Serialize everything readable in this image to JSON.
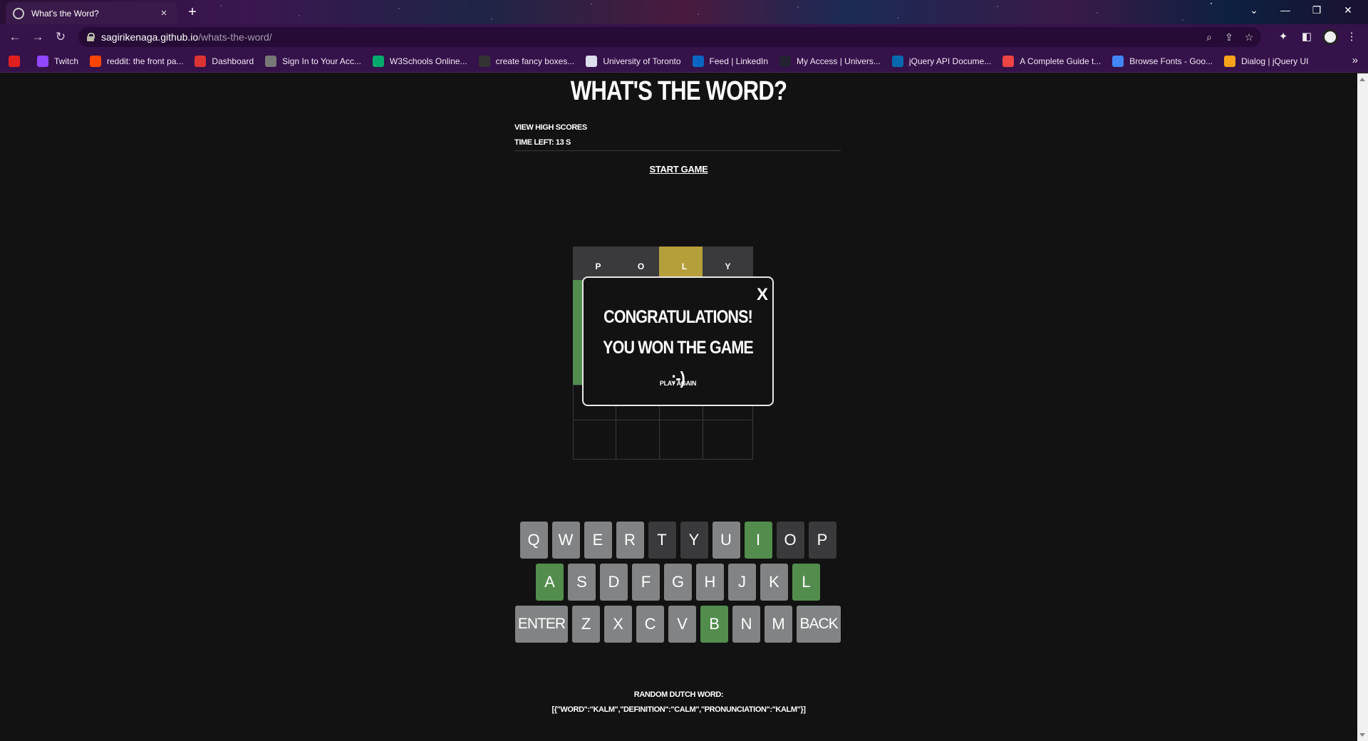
{
  "browser": {
    "tab_title": "What's the Word?",
    "tab_close": "×",
    "new_tab": "+",
    "url_host": "sagirikenaga.github.io",
    "url_path": "/whats-the-word/",
    "bookmarks": [
      {
        "label": "",
        "icon": "youtube-icon",
        "color": "#e02020"
      },
      {
        "label": "Twitch",
        "icon": "twitch-icon",
        "color": "#9146ff"
      },
      {
        "label": "reddit: the front pa...",
        "icon": "reddit-icon",
        "color": "#ff4500"
      },
      {
        "label": "Dashboard",
        "icon": "dashboard-icon",
        "color": "#d33"
      },
      {
        "label": "Sign In to Your Acc...",
        "icon": "globe-icon",
        "color": "#777"
      },
      {
        "label": "W3Schools Online...",
        "icon": "w3schools-icon",
        "color": "#04aa6d"
      },
      {
        "label": "create fancy boxes...",
        "icon": "medium-icon",
        "color": "#333"
      },
      {
        "label": "University of Toronto",
        "icon": "uoft-icon",
        "color": "#dde"
      },
      {
        "label": "Feed | LinkedIn",
        "icon": "linkedin-icon",
        "color": "#0a66c2"
      },
      {
        "label": "My Access | Univers...",
        "icon": "access-icon",
        "color": "#223"
      },
      {
        "label": "jQuery API Docume...",
        "icon": "jquery-icon",
        "color": "#0769ad"
      },
      {
        "label": "A Complete Guide t...",
        "icon": "css-tricks-icon",
        "color": "#e44"
      },
      {
        "label": "Browse Fonts - Goo...",
        "icon": "google-fonts-icon",
        "color": "#4285f4"
      },
      {
        "label": "Dialog | jQuery UI",
        "icon": "jquery-ui-icon",
        "color": "#f7a21b"
      }
    ]
  },
  "header": {
    "title": "What's the Word?",
    "view_high_scores": "View High Scores",
    "time_left": "Time left: 13 s",
    "start_game": "Start Game"
  },
  "board": {
    "rows": [
      [
        {
          "l": "P",
          "s": "gray"
        },
        {
          "l": "O",
          "s": "gray"
        },
        {
          "l": "L",
          "s": "yellow"
        },
        {
          "l": "Y",
          "s": "gray"
        }
      ],
      [
        {
          "l": "",
          "s": "green"
        },
        {
          "l": "",
          "s": "gray"
        },
        {
          "l": "",
          "s": "gray"
        },
        {
          "l": "",
          "s": "green"
        }
      ],
      [
        {
          "l": "",
          "s": "green"
        },
        {
          "l": "",
          "s": "gray"
        },
        {
          "l": "",
          "s": "gray"
        },
        {
          "l": "",
          "s": "gray"
        }
      ],
      [
        {
          "l": "",
          "s": "green"
        },
        {
          "l": "",
          "s": "green"
        },
        {
          "l": "",
          "s": "green"
        },
        {
          "l": "",
          "s": "green"
        }
      ],
      [
        {
          "l": "",
          "s": "empty"
        },
        {
          "l": "",
          "s": "empty"
        },
        {
          "l": "",
          "s": "empty"
        },
        {
          "l": "",
          "s": "empty"
        }
      ],
      [
        {
          "l": "",
          "s": "empty"
        },
        {
          "l": "",
          "s": "empty"
        },
        {
          "l": "",
          "s": "empty"
        },
        {
          "l": "",
          "s": "empty"
        }
      ]
    ]
  },
  "modal": {
    "close_label": "X",
    "message": "Congratulations! You won the game :-)",
    "play_again": "Play Again"
  },
  "keyboard": {
    "rows": [
      [
        {
          "k": "Q",
          "s": "gray"
        },
        {
          "k": "W",
          "s": "gray"
        },
        {
          "k": "E",
          "s": "gray"
        },
        {
          "k": "R",
          "s": "gray"
        },
        {
          "k": "T",
          "s": "dark"
        },
        {
          "k": "Y",
          "s": "dark"
        },
        {
          "k": "U",
          "s": "gray"
        },
        {
          "k": "I",
          "s": "green"
        },
        {
          "k": "O",
          "s": "dark"
        },
        {
          "k": "P",
          "s": "dark"
        }
      ],
      [
        {
          "k": "A",
          "s": "green"
        },
        {
          "k": "S",
          "s": "gray"
        },
        {
          "k": "D",
          "s": "gray"
        },
        {
          "k": "F",
          "s": "gray"
        },
        {
          "k": "G",
          "s": "gray"
        },
        {
          "k": "H",
          "s": "gray"
        },
        {
          "k": "J",
          "s": "gray"
        },
        {
          "k": "K",
          "s": "gray"
        },
        {
          "k": "L",
          "s": "green"
        }
      ],
      [
        {
          "k": "ENTER",
          "s": "gray",
          "wide": true
        },
        {
          "k": "Z",
          "s": "gray"
        },
        {
          "k": "X",
          "s": "gray"
        },
        {
          "k": "C",
          "s": "gray"
        },
        {
          "k": "V",
          "s": "gray"
        },
        {
          "k": "B",
          "s": "green"
        },
        {
          "k": "N",
          "s": "gray"
        },
        {
          "k": "M",
          "s": "gray"
        },
        {
          "k": "BACK",
          "s": "gray",
          "wide": true
        }
      ]
    ]
  },
  "footer": {
    "label": "Random Dutch Word:",
    "json": "[{\"word\":\"kalm\",\"definition\":\"calm\",\"pronunciation\":\"kalm\"}]"
  },
  "colors": {
    "green": "#538d4e",
    "yellow": "#b59f3b",
    "gray": "#3a3a3c",
    "key_gray": "#818384"
  }
}
